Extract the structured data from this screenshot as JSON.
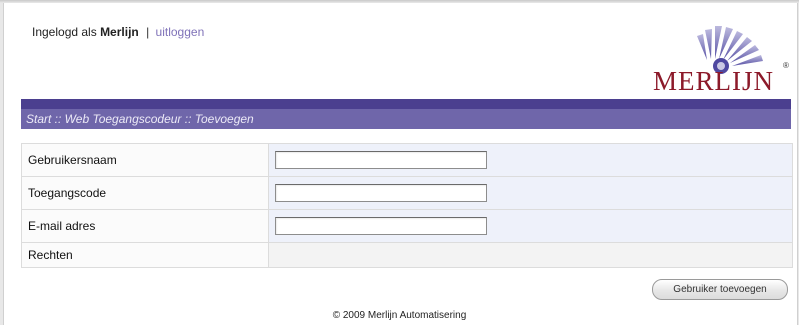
{
  "header": {
    "logged_in_prefix": "Ingelogd als",
    "username": "Merlijn",
    "separator": "|",
    "logout_label": "uitloggen",
    "logo_text": "MERLIJN",
    "logo_mark": "®"
  },
  "breadcrumb": "Start :: Web Toegangscodeur :: Toevoegen",
  "form": {
    "username_label": "Gebruikersnaam",
    "username_value": "",
    "code_label": "Toegangscode",
    "code_value": "",
    "email_label": "E-mail adres",
    "email_value": "",
    "rights_label": "Rechten"
  },
  "actions": {
    "add_user_label": "Gebruiker toevoegen"
  },
  "footer": "© 2009 Merlijn Automatisering",
  "colors": {
    "band_dark": "#4b3f8f",
    "band_light": "#6f66aa",
    "logo_red": "#8c1a2a",
    "link": "#7f72b8"
  }
}
